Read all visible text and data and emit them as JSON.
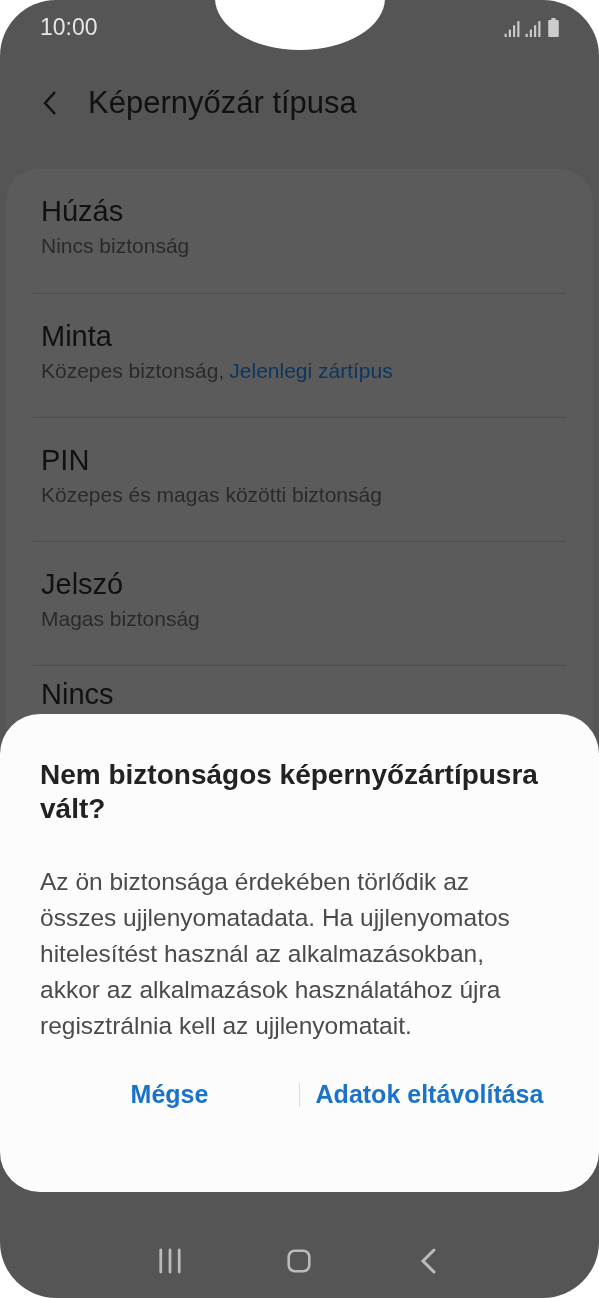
{
  "status_bar": {
    "time": "10:00"
  },
  "header": {
    "title": "Képernyőzár típusa"
  },
  "lock_types": [
    {
      "title": "Húzás",
      "subtitle": "Nincs biztonság"
    },
    {
      "title": "Minta",
      "subtitle": "Közepes biztonság,",
      "status": "Jelenlegi zártípus"
    },
    {
      "title": "PIN",
      "subtitle": "Közepes és magas közötti biztonság"
    },
    {
      "title": "Jelszó",
      "subtitle": "Magas biztonság"
    },
    {
      "title": "Nincs"
    }
  ],
  "dialog": {
    "title": "Nem biztonságos képernyőzártípusra vált?",
    "message": "Az ön biztonsága érdekében törlődik az összes ujjlenyomatadata. Ha ujjlenyomatos hitelesítést használ az alkalmazásokban, akkor az alkalmazások használatához újra regisztrálnia kell az ujjlenyomatait.",
    "buttons": [
      "Mégse",
      "Adatok eltávolítása"
    ]
  }
}
